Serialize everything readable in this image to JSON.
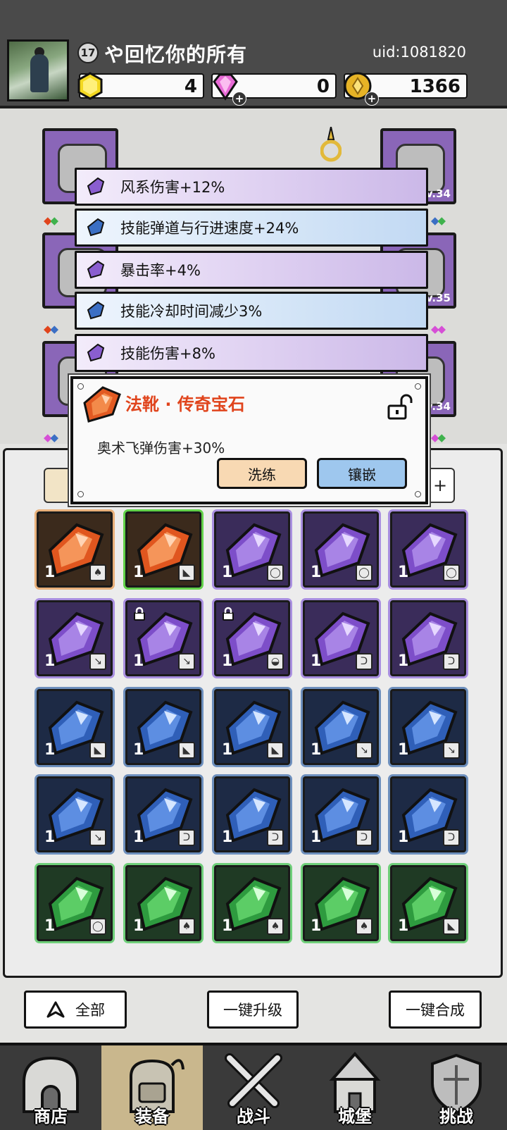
{
  "player": {
    "level": "17",
    "name": "や回忆你的所有",
    "uid": "uid:1081820"
  },
  "resources": [
    {
      "icon": "yellow-gem-icon",
      "value": "4"
    },
    {
      "icon": "pink-diamond-icon",
      "value": "0"
    },
    {
      "icon": "gold-coin-icon",
      "value": "1366"
    }
  ],
  "equipment_slots": [
    {
      "icon": "helmet-icon",
      "level": ""
    },
    {
      "icon": "weapon-icon",
      "level": "Lv.34"
    },
    {
      "icon": "armor-icon",
      "level": ""
    },
    {
      "icon": "ring-icon",
      "level": "Lv.35"
    },
    {
      "icon": "boots-icon",
      "level": ""
    },
    {
      "icon": "necklace-icon",
      "level": "Lv.34"
    }
  ],
  "stats": [
    {
      "color": "purple",
      "text": "风系伤害+12%"
    },
    {
      "color": "blue",
      "text": "技能弹道与行进速度+24%"
    },
    {
      "color": "purple",
      "text": "暴击率+4%"
    },
    {
      "color": "blue",
      "text": "技能冷却时间减少3%"
    },
    {
      "color": "purple",
      "text": "技能伤害+8%"
    }
  ],
  "gem_popup": {
    "title": "法靴 · 传奇宝石",
    "description": "奥术飞弹伤害+30%",
    "wash_label": "洗练",
    "inlay_label": "镶嵌"
  },
  "inventory": [
    {
      "tier": "orange",
      "count": "1",
      "type": "armor"
    },
    {
      "tier": "orange",
      "count": "1",
      "type": "boots",
      "selected": true
    },
    {
      "tier": "purple",
      "count": "1",
      "type": "ring"
    },
    {
      "tier": "purple",
      "count": "1",
      "type": "ring"
    },
    {
      "tier": "purple",
      "count": "1",
      "type": "ring"
    },
    {
      "tier": "purple",
      "count": "1",
      "type": "weapon"
    },
    {
      "tier": "purple",
      "count": "1",
      "type": "weapon",
      "locked": true
    },
    {
      "tier": "purple",
      "count": "1",
      "type": "helmet",
      "locked": true
    },
    {
      "tier": "purple",
      "count": "1",
      "type": "necklace"
    },
    {
      "tier": "purple",
      "count": "1",
      "type": "necklace"
    },
    {
      "tier": "blue",
      "count": "1",
      "type": "boots"
    },
    {
      "tier": "blue",
      "count": "1",
      "type": "boots"
    },
    {
      "tier": "blue",
      "count": "1",
      "type": "boots"
    },
    {
      "tier": "blue",
      "count": "1",
      "type": "weapon"
    },
    {
      "tier": "blue",
      "count": "1",
      "type": "weapon"
    },
    {
      "tier": "blue",
      "count": "1",
      "type": "weapon"
    },
    {
      "tier": "blue",
      "count": "1",
      "type": "necklace"
    },
    {
      "tier": "blue",
      "count": "1",
      "type": "necklace"
    },
    {
      "tier": "blue",
      "count": "1",
      "type": "necklace"
    },
    {
      "tier": "blue",
      "count": "1",
      "type": "necklace"
    },
    {
      "tier": "green",
      "count": "1",
      "type": "ring"
    },
    {
      "tier": "green",
      "count": "1",
      "type": "armor"
    },
    {
      "tier": "green",
      "count": "1",
      "type": "armor"
    },
    {
      "tier": "green",
      "count": "1",
      "type": "armor"
    },
    {
      "tier": "green",
      "count": "1",
      "type": "boots"
    }
  ],
  "actions": {
    "filter_label": "全部",
    "upgrade_label": "一键升级",
    "merge_label": "一键合成"
  },
  "nav": [
    {
      "label": "商店",
      "icon": "shop-icon"
    },
    {
      "label": "装备",
      "icon": "backpack-icon",
      "active": true
    },
    {
      "label": "战斗",
      "icon": "crossed-swords-icon"
    },
    {
      "label": "城堡",
      "icon": "castle-icon"
    },
    {
      "label": "挑战",
      "icon": "shield-icon"
    }
  ],
  "colors": {
    "orange": "#e0441c",
    "purple": "#8a66b8",
    "blue": "#3b6fc4",
    "green": "#3fb24d"
  }
}
